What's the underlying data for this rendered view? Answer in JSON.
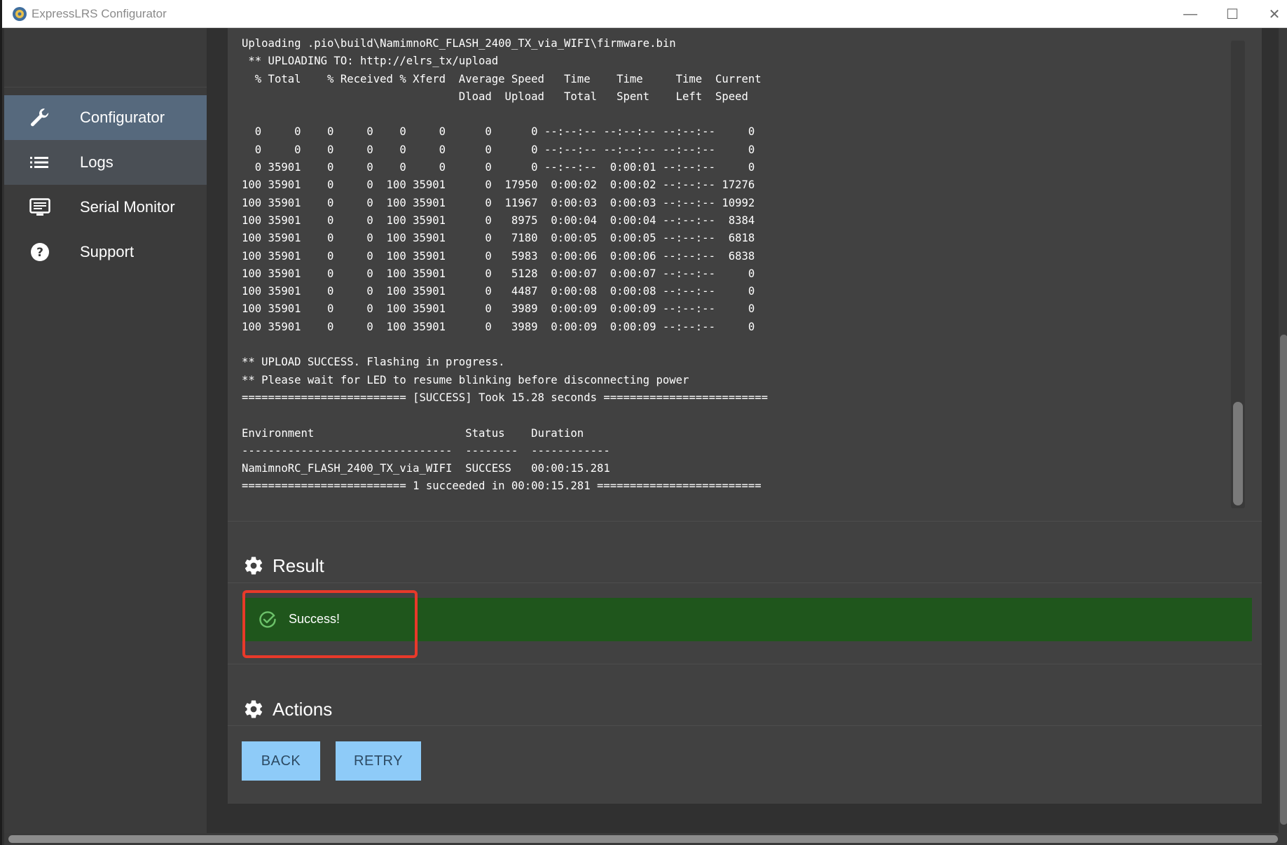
{
  "window": {
    "title": "ExpressLRS Configurator",
    "minimize_glyph": "—",
    "maximize_glyph": "☐",
    "close_glyph": "✕"
  },
  "sidebar": {
    "items": [
      {
        "label": "Configurator",
        "icon": "wrench-icon",
        "active": true
      },
      {
        "label": "Logs",
        "icon": "list-icon",
        "active": false
      },
      {
        "label": "Serial Monitor",
        "icon": "monitor-icon",
        "active": false
      },
      {
        "label": "Support",
        "icon": "help-icon",
        "active": false
      }
    ]
  },
  "log": {
    "lines": [
      "Uploading .pio\\build\\NamimnoRC_FLASH_2400_TX_via_WIFI\\firmware.bin",
      " ** UPLOADING TO: http://elrs_tx/upload",
      "  % Total    % Received % Xferd  Average Speed   Time    Time     Time  Current",
      "                                 Dload  Upload   Total   Spent    Left  Speed",
      "",
      "  0     0    0     0    0     0      0      0 --:--:-- --:--:-- --:--:--     0",
      "  0     0    0     0    0     0      0      0 --:--:-- --:--:-- --:--:--     0",
      "  0 35901    0     0    0     0      0      0 --:--:--  0:00:01 --:--:--     0",
      "100 35901    0     0  100 35901      0  17950  0:00:02  0:00:02 --:--:-- 17276",
      "100 35901    0     0  100 35901      0  11967  0:00:03  0:00:03 --:--:-- 10992",
      "100 35901    0     0  100 35901      0   8975  0:00:04  0:00:04 --:--:--  8384",
      "100 35901    0     0  100 35901      0   7180  0:00:05  0:00:05 --:--:--  6818",
      "100 35901    0     0  100 35901      0   5983  0:00:06  0:00:06 --:--:--  6838",
      "100 35901    0     0  100 35901      0   5128  0:00:07  0:00:07 --:--:--     0",
      "100 35901    0     0  100 35901      0   4487  0:00:08  0:00:08 --:--:--     0",
      "100 35901    0     0  100 35901      0   3989  0:00:09  0:00:09 --:--:--     0",
      "100 35901    0     0  100 35901      0   3989  0:00:09  0:00:09 --:--:--     0",
      "",
      "** UPLOAD SUCCESS. Flashing in progress.",
      "** Please wait for LED to resume blinking before disconnecting power",
      "========================= [SUCCESS] Took 15.28 seconds =========================",
      "",
      "Environment                       Status    Duration",
      "--------------------------------  --------  ------------",
      "NamimnoRC_FLASH_2400_TX_via_WIFI  SUCCESS   00:00:15.281",
      "========================= 1 succeeded in 00:00:15.281 ========================="
    ]
  },
  "result": {
    "heading": "Result",
    "message": "Success!"
  },
  "actions": {
    "heading": "Actions",
    "back_label": "BACK",
    "retry_label": "RETRY"
  },
  "colors": {
    "success_bg": "#1f561c",
    "highlight": "#e8392a",
    "button_bg": "#8ecbf8",
    "active_nav": "#56697d"
  }
}
